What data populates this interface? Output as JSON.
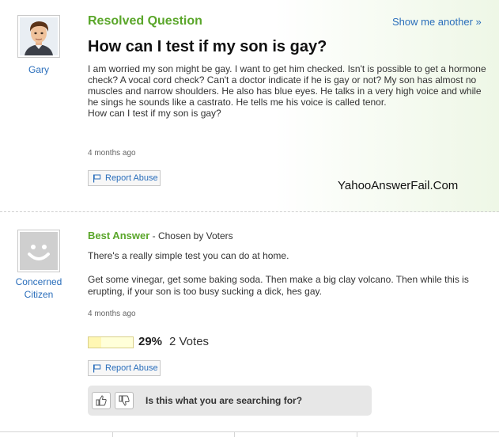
{
  "question": {
    "status_label": "Resolved Question",
    "show_another": "Show me another »",
    "asker_name": "Gary",
    "title": "How can I test if my son is gay?",
    "body": [
      "I am worried my son might be gay. I want to get him checked. Isn't is possible to get a hormone check? A vocal cord check? Can't a doctor indicate if he is gay or not? My son has almost no muscles and narrow shoulders. He also has blue eyes. He talks in a very high voice and while he sings he sounds like a castrato. He tells me his voice is called tenor.",
      "How can I test if my son is gay?"
    ],
    "timestamp": "4 months ago",
    "report_abuse": "Report Abuse"
  },
  "watermark": "YahooAnswerFail.Com",
  "answer": {
    "label": "Best Answer",
    "chosen_by": " - Chosen by Voters",
    "answerer_name_line1": "Concerned",
    "answerer_name_line2": "Citizen",
    "body": [
      "There's a really simple test you can do at home.",
      "Get some vinegar, get some baking soda. Then make a big clay volcano. Then while this is erupting, if your son is too busy sucking a dick, hes gay."
    ],
    "timestamp": "4 months ago",
    "vote_fraction": 0.29,
    "vote_percent": "29%",
    "vote_count": "2 Votes",
    "report_abuse": "Report Abuse"
  },
  "search_prompt": {
    "text": "Is this what you are searching for?",
    "thumb_up_icon": "thumbs-up-icon",
    "thumb_down_icon": "thumbs-down-icon"
  },
  "colors": {
    "accent_green": "#5aa62a",
    "link_blue": "#2a6ebb"
  }
}
